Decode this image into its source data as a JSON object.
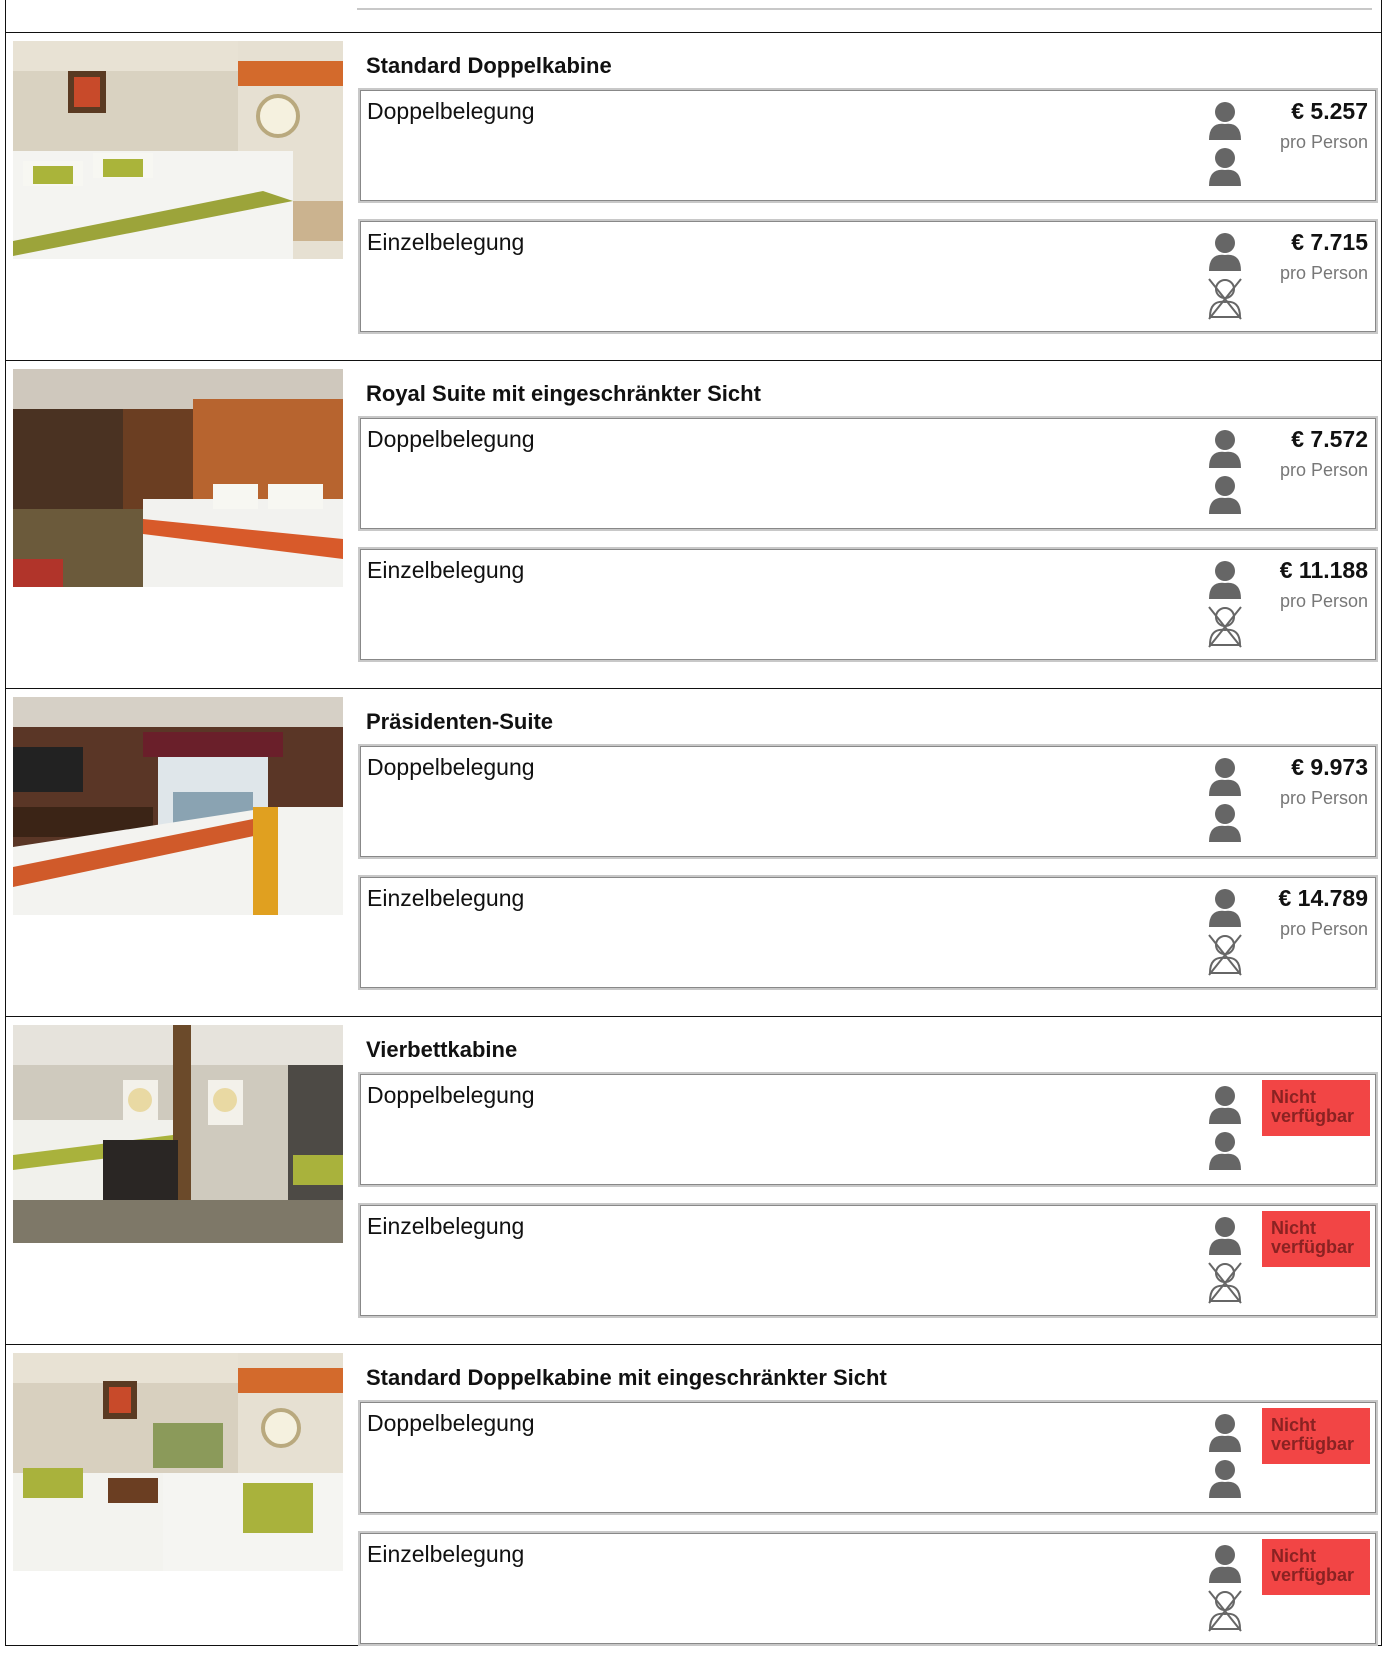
{
  "colors": {
    "border": "#111111",
    "option_border": "#c8c8c8",
    "icon": "#666666",
    "unavailable_bg": "#f24545",
    "unavailable_text": "#8a2222",
    "price_sub": "#777777"
  },
  "cabins": [
    {
      "title": "Standard Doppelkabine",
      "photo": "cabin-photo-standard",
      "options": [
        {
          "label": "Doppelbelegung",
          "occupancy_icons": [
            "person-icon",
            "person-icon"
          ],
          "price": "€ 5.257",
          "price_note": "pro Person",
          "available": true
        },
        {
          "label": "Einzelbelegung",
          "occupancy_icons": [
            "person-icon",
            "person-crossed-icon"
          ],
          "price": "€ 7.715",
          "price_note": "pro Person",
          "available": true
        }
      ]
    },
    {
      "title": "Royal Suite mit eingeschränkter Sicht",
      "photo": "cabin-photo-royal-suite",
      "options": [
        {
          "label": "Doppelbelegung",
          "occupancy_icons": [
            "person-icon",
            "person-icon"
          ],
          "price": "€ 7.572",
          "price_note": "pro Person",
          "available": true
        },
        {
          "label": "Einzelbelegung",
          "occupancy_icons": [
            "person-icon",
            "person-crossed-icon"
          ],
          "price": "€ 11.188",
          "price_note": "pro Person",
          "available": true
        }
      ]
    },
    {
      "title": "Präsidenten-Suite",
      "photo": "cabin-photo-presidential-suite",
      "options": [
        {
          "label": "Doppelbelegung",
          "occupancy_icons": [
            "person-icon",
            "person-icon"
          ],
          "price": "€ 9.973",
          "price_note": "pro Person",
          "available": true
        },
        {
          "label": "Einzelbelegung",
          "occupancy_icons": [
            "person-icon",
            "person-crossed-icon"
          ],
          "price": "€ 14.789",
          "price_note": "pro Person",
          "available": true
        }
      ]
    },
    {
      "title": "Vierbettkabine",
      "photo": "cabin-photo-four-bed",
      "options": [
        {
          "label": "Doppelbelegung",
          "occupancy_icons": [
            "person-icon",
            "person-icon"
          ],
          "unavailable_text": "Nicht verfügbar",
          "available": false
        },
        {
          "label": "Einzelbelegung",
          "occupancy_icons": [
            "person-icon",
            "person-crossed-icon"
          ],
          "unavailable_text": "Nicht verfügbar",
          "available": false
        }
      ]
    },
    {
      "title": "Standard Doppelkabine mit eingeschränkter Sicht",
      "photo": "cabin-photo-standard-restricted",
      "options": [
        {
          "label": "Doppelbelegung",
          "occupancy_icons": [
            "person-icon",
            "person-icon"
          ],
          "unavailable_text": "Nicht verfügbar",
          "available": false
        },
        {
          "label": "Einzelbelegung",
          "occupancy_icons": [
            "person-icon",
            "person-crossed-icon"
          ],
          "unavailable_text": "Nicht verfügbar",
          "available": false
        }
      ]
    }
  ]
}
